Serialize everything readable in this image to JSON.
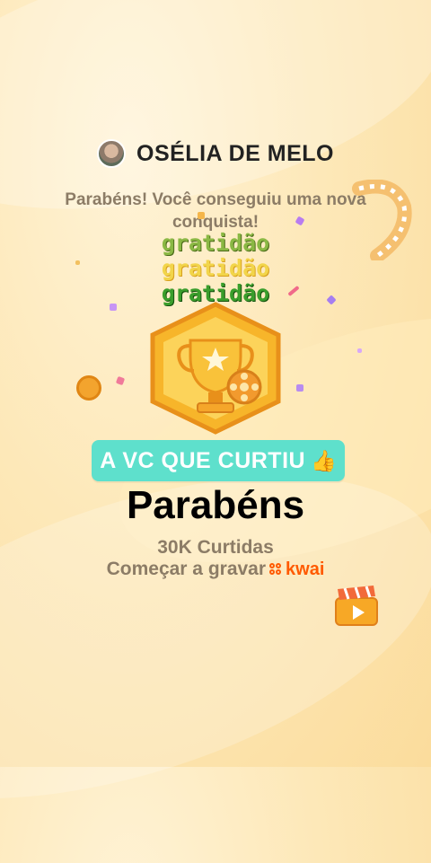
{
  "header": {
    "username": "OSÉLIA DE MELO"
  },
  "subtitle": "Parabéns! Você conseguiu uma nova conquista!",
  "sticker_words": [
    "gratidão",
    "gratidão",
    "gratidão"
  ],
  "banner": {
    "text": "A VC QUE CURTIU",
    "icon": "thumbs-up-icon"
  },
  "main": {
    "title": "Parabéns",
    "likes": "30K Curtidas",
    "record_text": "Começar a gravar",
    "brand": "kwai"
  },
  "colors": {
    "banner": "#5ee0cc",
    "brand": "#ff5a00",
    "muted_text": "#8c7c66"
  }
}
